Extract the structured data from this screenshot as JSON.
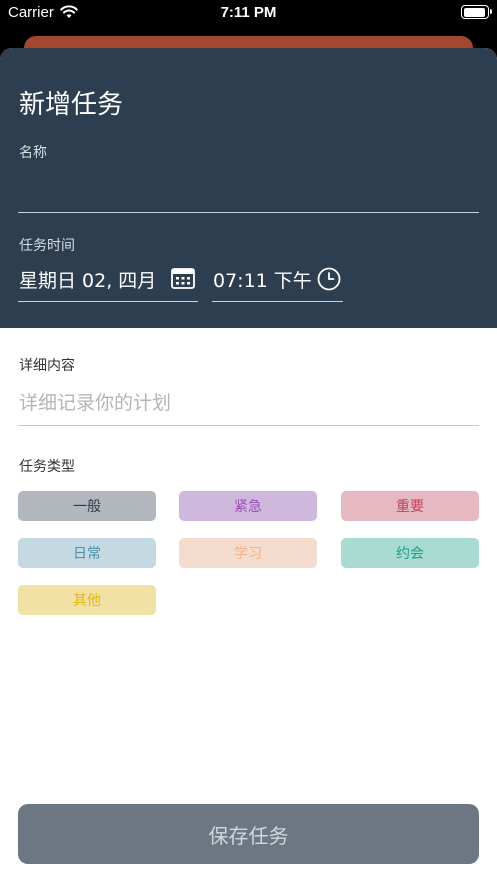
{
  "status_bar": {
    "carrier": "Carrier",
    "time": "7:11 PM"
  },
  "form": {
    "title": "新增任务",
    "name_label": "名称",
    "name_value": "",
    "time_label": "任务时间",
    "date_value": "星期日 02, 四月",
    "time_value": "07:11 下午",
    "detail_label": "详细内容",
    "detail_placeholder": "详细记录你的计划",
    "type_label": "任务类型"
  },
  "task_types": [
    {
      "label": "一般",
      "bg": "#b2b7be",
      "fg": "#2f3a46"
    },
    {
      "label": "紧急",
      "bg": "#cfb8dd",
      "fg": "#9a4fb5"
    },
    {
      "label": "重要",
      "bg": "#e6b8c2",
      "fg": "#c0405a"
    },
    {
      "label": "日常",
      "bg": "#c5d9e2",
      "fg": "#4f8dac"
    },
    {
      "label": "学习",
      "bg": "#f3dccd",
      "fg": "#f2b58d"
    },
    {
      "label": "约会",
      "bg": "#a9dbd2",
      "fg": "#1f9f85"
    },
    {
      "label": "其他",
      "bg": "#f1e1a4",
      "fg": "#e3b90b"
    }
  ],
  "save_button": "保存任务",
  "icons": {
    "date": "calendar-icon",
    "time": "clock-icon"
  }
}
